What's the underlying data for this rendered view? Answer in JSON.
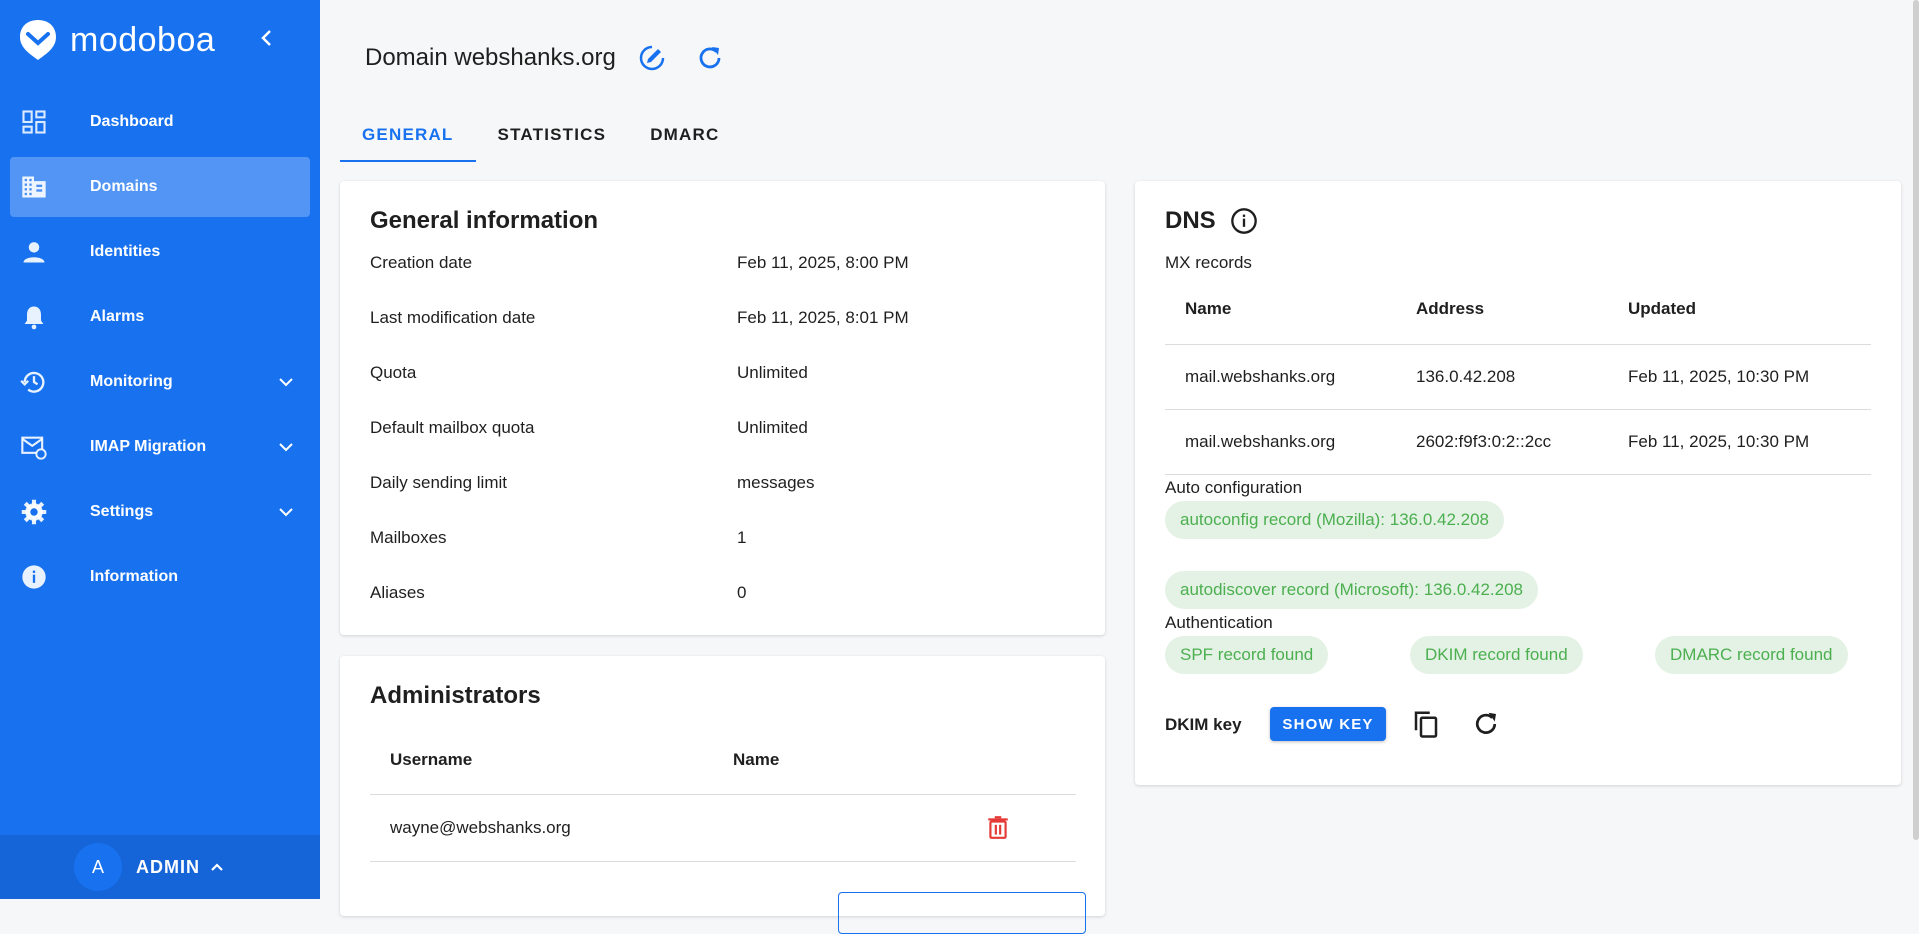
{
  "app": {
    "name": "modoboa"
  },
  "sidebar": {
    "items": [
      {
        "label": "Dashboard",
        "icon": "dashboard-icon"
      },
      {
        "label": "Domains",
        "icon": "domains-icon",
        "active": true
      },
      {
        "label": "Identities",
        "icon": "person-icon"
      },
      {
        "label": "Alarms",
        "icon": "bell-icon"
      },
      {
        "label": "Monitoring",
        "icon": "history-icon",
        "expandable": true
      },
      {
        "label": "IMAP Migration",
        "icon": "mail-sync-icon",
        "expandable": true
      },
      {
        "label": "Settings",
        "icon": "gear-icon",
        "expandable": true
      },
      {
        "label": "Information",
        "icon": "info-icon"
      }
    ],
    "footer": {
      "avatar_letter": "A",
      "user": "ADMIN"
    }
  },
  "header": {
    "title": "Domain webshanks.org"
  },
  "tabs": [
    {
      "label": "GENERAL",
      "active": true
    },
    {
      "label": "STATISTICS"
    },
    {
      "label": "DMARC"
    }
  ],
  "general": {
    "title": "General information",
    "rows": [
      {
        "label": "Creation date",
        "value": "Feb 11, 2025, 8:00 PM"
      },
      {
        "label": "Last modification date",
        "value": "Feb 11, 2025, 8:01 PM"
      },
      {
        "label": "Quota",
        "value": "Unlimited"
      },
      {
        "label": "Default mailbox quota",
        "value": "Unlimited"
      },
      {
        "label": "Daily sending limit",
        "value": "messages"
      },
      {
        "label": "Mailboxes",
        "value": "1"
      },
      {
        "label": "Aliases",
        "value": "0"
      }
    ]
  },
  "administrators": {
    "title": "Administrators",
    "headers": {
      "username": "Username",
      "name": "Name"
    },
    "rows": [
      {
        "username": "wayne@webshanks.org",
        "name": ""
      }
    ]
  },
  "dns": {
    "title": "DNS",
    "mx_label": "MX records",
    "mx_headers": {
      "name": "Name",
      "address": "Address",
      "updated": "Updated"
    },
    "mx_rows": [
      {
        "name": "mail.webshanks.org",
        "address": "136.0.42.208",
        "updated": "Feb 11, 2025, 10:30 PM"
      },
      {
        "name": "mail.webshanks.org",
        "address": "2602:f9f3:0:2::2cc",
        "updated": "Feb 11, 2025, 10:30 PM"
      }
    ],
    "autoconf_label": "Auto configuration",
    "autoconf_chips": [
      "autoconfig record (Mozilla): 136.0.42.208",
      "autodiscover record (Microsoft): 136.0.42.208"
    ],
    "auth_label": "Authentication",
    "auth_chips": [
      "SPF record found",
      "DKIM record found",
      "DMARC record found"
    ],
    "dkim_label": "DKIM key",
    "show_key_label": "SHOW KEY"
  },
  "colors": {
    "brand": "#1872f0",
    "success_text": "#4caf50",
    "success_bg": "#e3f2e4",
    "danger": "#e53935"
  }
}
